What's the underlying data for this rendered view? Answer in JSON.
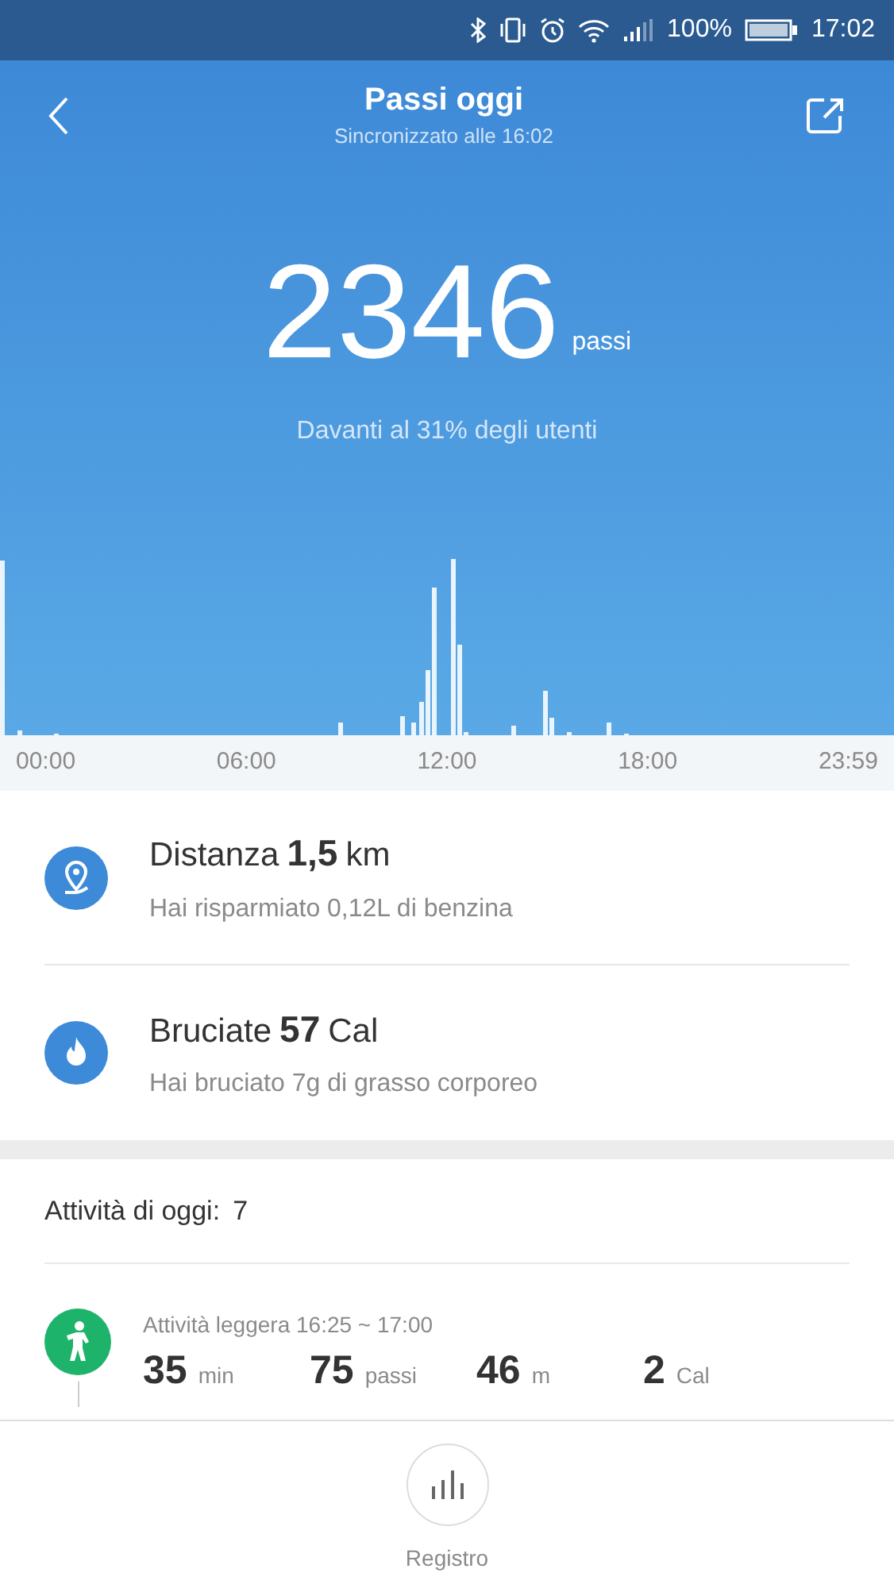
{
  "status_bar": {
    "battery": "100%",
    "time": "17:02"
  },
  "header": {
    "title": "Passi oggi",
    "subtitle": "Sincronizzato alle 16:02"
  },
  "steps": {
    "value": "2346",
    "unit": "passi",
    "ranking": "Davanti al 31% degli utenti"
  },
  "timeline": {
    "axis_labels": [
      "00:00",
      "06:00",
      "12:00",
      "18:00",
      "23:59"
    ]
  },
  "stats": [
    {
      "kind": "distance",
      "label": "Distanza",
      "value": "1,5",
      "unit": "km",
      "note": "Hai risparmiato 0,12L di benzina"
    },
    {
      "kind": "calories",
      "label": "Bruciate",
      "value": "57",
      "unit": "Cal",
      "note": "Hai bruciato 7g di grasso corporeo"
    }
  ],
  "activities": {
    "label": "Attività di oggi:",
    "count": "7",
    "items": [
      {
        "title": "Attività leggera 16:25 ~ 17:00",
        "metrics": [
          {
            "value": "35",
            "unit": "min"
          },
          {
            "value": "75",
            "unit": "passi"
          },
          {
            "value": "46",
            "unit": "m"
          },
          {
            "value": "2",
            "unit": "Cal"
          }
        ]
      }
    ]
  },
  "bottom_nav": {
    "label": "Registro"
  }
}
